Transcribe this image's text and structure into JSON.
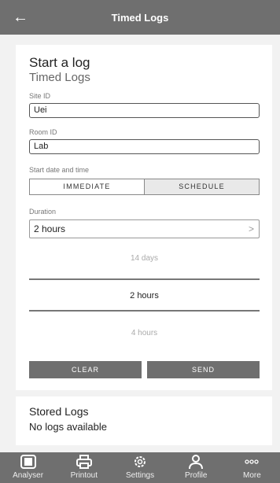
{
  "appbar": {
    "title": "Timed Logs"
  },
  "start": {
    "title": "Start a log",
    "subtitle": "Timed Logs",
    "site_label": "Site ID",
    "site_value": "Uei",
    "room_label": "Room ID",
    "room_value": "Lab",
    "datetime_label": "Start date and time",
    "immediate_label": "IMMEDIATE",
    "schedule_label": "SCHEDULE",
    "duration_label": "Duration",
    "duration_value": "2 hours",
    "picker": {
      "above": "14 days",
      "selected": "2 hours",
      "below": "4 hours"
    },
    "clear_label": "CLEAR",
    "send_label": "SEND"
  },
  "stored": {
    "title": "Stored Logs",
    "empty": "No logs available"
  },
  "nav": [
    {
      "label": "Analyser",
      "icon": "analyser-icon"
    },
    {
      "label": "Printout",
      "icon": "printer-icon"
    },
    {
      "label": "Settings",
      "icon": "gear-icon"
    },
    {
      "label": "Profile",
      "icon": "person-icon"
    },
    {
      "label": "More",
      "icon": "more-dots-icon"
    }
  ]
}
